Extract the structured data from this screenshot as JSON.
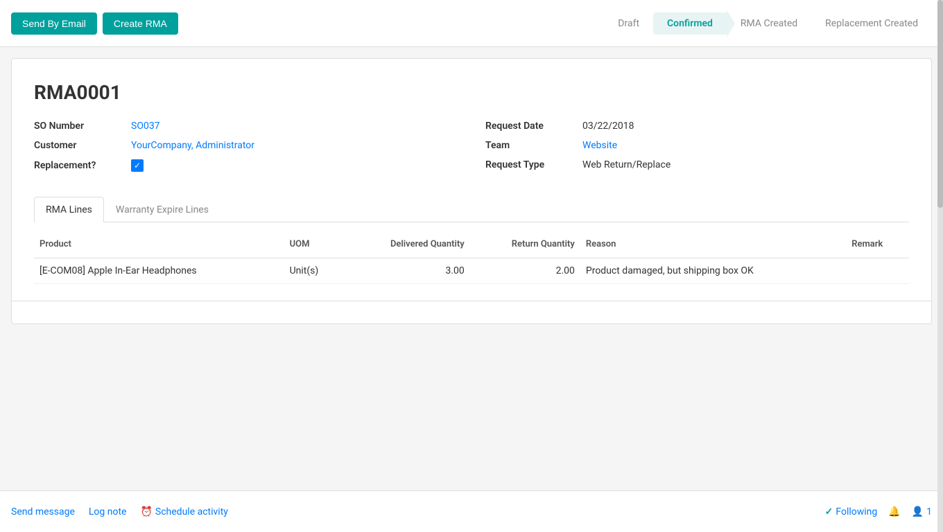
{
  "toolbar": {
    "send_by_email_label": "Send By Email",
    "create_rma_label": "Create RMA"
  },
  "status_bar": {
    "steps": [
      {
        "id": "draft",
        "label": "Draft",
        "active": false
      },
      {
        "id": "confirmed",
        "label": "Confirmed",
        "active": true
      },
      {
        "id": "rma_created",
        "label": "RMA Created",
        "active": false
      },
      {
        "id": "replacement_created",
        "label": "Replacement Created",
        "active": false
      }
    ]
  },
  "record": {
    "title": "RMA0001",
    "fields_left": [
      {
        "id": "so_number",
        "label": "SO Number",
        "value": "SO037",
        "is_link": true
      },
      {
        "id": "customer",
        "label": "Customer",
        "value": "YourCompany, Administrator",
        "is_link": true
      },
      {
        "id": "replacement",
        "label": "Replacement?",
        "value": "checked",
        "is_checkbox": true
      }
    ],
    "fields_right": [
      {
        "id": "request_date",
        "label": "Request Date",
        "value": "03/22/2018",
        "is_link": false
      },
      {
        "id": "team",
        "label": "Team",
        "value": "Website",
        "is_link": true
      },
      {
        "id": "request_type",
        "label": "Request Type",
        "value": "Web Return/Replace",
        "is_link": false
      }
    ]
  },
  "tabs": [
    {
      "id": "rma_lines",
      "label": "RMA Lines",
      "active": true
    },
    {
      "id": "warranty_expire_lines",
      "label": "Warranty Expire Lines",
      "active": false
    }
  ],
  "table": {
    "headers": [
      {
        "id": "product",
        "label": "Product"
      },
      {
        "id": "uom",
        "label": "UOM"
      },
      {
        "id": "delivered_quantity",
        "label": "Delivered Quantity"
      },
      {
        "id": "return_quantity",
        "label": "Return Quantity"
      },
      {
        "id": "reason",
        "label": "Reason"
      },
      {
        "id": "remark",
        "label": "Remark"
      }
    ],
    "rows": [
      {
        "product": "[E-COM08] Apple In-Ear Headphones",
        "uom": "Unit(s)",
        "delivered_quantity": "3.00",
        "return_quantity": "2.00",
        "reason": "Product damaged, but shipping box OK",
        "remark": ""
      }
    ]
  },
  "bottom_bar": {
    "send_message_label": "Send message",
    "log_note_label": "Log note",
    "schedule_activity_label": "Schedule activity",
    "following_label": "Following",
    "followers_count": "1"
  }
}
